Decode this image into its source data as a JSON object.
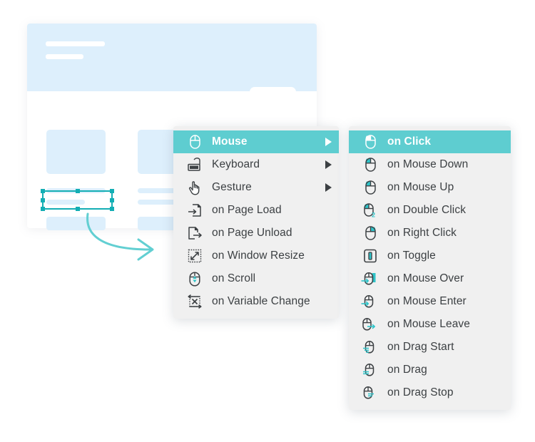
{
  "colors": {
    "accent_teal": "#5ecdd0",
    "accent_teal_dark": "#13aeb4",
    "mockup_blue": "#ddeffc",
    "menu_bg": "#f0f0f0",
    "menu_text": "#3c4043",
    "highlight_text": "#ffffff"
  },
  "mockup": {
    "name": "webpage-wireframe-preview",
    "selected_element": "button-placeholder"
  },
  "primary_menu": {
    "name": "event-trigger-menu",
    "items": [
      {
        "label": "Mouse",
        "icon": "mouse-icon",
        "has_submenu": true,
        "highlighted": true
      },
      {
        "label": "Keyboard",
        "icon": "keyboard-icon",
        "has_submenu": true,
        "highlighted": false
      },
      {
        "label": "Gesture",
        "icon": "hand-pointer-icon",
        "has_submenu": true,
        "highlighted": false
      },
      {
        "label": "on Page Load",
        "icon": "page-load-icon",
        "has_submenu": false,
        "highlighted": false
      },
      {
        "label": "on Page Unload",
        "icon": "page-unload-icon",
        "has_submenu": false,
        "highlighted": false
      },
      {
        "label": "on Window Resize",
        "icon": "window-resize-icon",
        "has_submenu": false,
        "highlighted": false
      },
      {
        "label": "on Scroll",
        "icon": "mouse-scroll-icon",
        "has_submenu": false,
        "highlighted": false
      },
      {
        "label": "on Variable Change",
        "icon": "variable-change-icon",
        "has_submenu": false,
        "highlighted": false
      }
    ]
  },
  "secondary_menu": {
    "name": "mouse-event-submenu",
    "items": [
      {
        "label": "on Click",
        "icon": "mouse-click-icon",
        "highlighted": true
      },
      {
        "label": "on Mouse Down",
        "icon": "mouse-down-icon",
        "highlighted": false
      },
      {
        "label": "on Mouse Up",
        "icon": "mouse-up-icon",
        "highlighted": false
      },
      {
        "label": "on Double Click",
        "icon": "mouse-double-click-icon",
        "highlighted": false
      },
      {
        "label": "on Right Click",
        "icon": "mouse-right-click-icon",
        "highlighted": false
      },
      {
        "label": "on Toggle",
        "icon": "toggle-icon",
        "highlighted": false
      },
      {
        "label": "on Mouse Over",
        "icon": "mouse-over-icon",
        "highlighted": false
      },
      {
        "label": "on Mouse Enter",
        "icon": "mouse-enter-icon",
        "highlighted": false
      },
      {
        "label": "on Mouse Leave",
        "icon": "mouse-leave-icon",
        "highlighted": false
      },
      {
        "label": "on Drag Start",
        "icon": "mouse-drag-start-icon",
        "highlighted": false
      },
      {
        "label": "on Drag",
        "icon": "mouse-drag-icon",
        "highlighted": false
      },
      {
        "label": "on Drag Stop",
        "icon": "mouse-drag-stop-icon",
        "highlighted": false
      }
    ]
  }
}
